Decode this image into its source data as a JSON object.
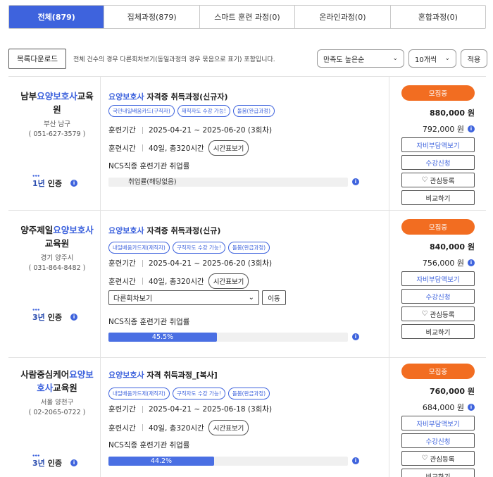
{
  "tabs": [
    {
      "label": "전체(879)",
      "active": true
    },
    {
      "label": "집체과정(879)"
    },
    {
      "label": "스마트 훈련 과정(0)"
    },
    {
      "label": "온라인과정(0)"
    },
    {
      "label": "혼합과정(0)"
    }
  ],
  "toolbar": {
    "download_label": "목록다운로드",
    "notice": "전체 건수의 경우 다른회차보기(동일과정의 경우 묶음으로 표기) 포함입니다.",
    "sort_value": "만족도 높은순",
    "count_value": "10개씩",
    "apply_label": "적용"
  },
  "labels": {
    "period": "훈련기간",
    "hours": "훈련시간",
    "timetable": "시간표보기",
    "ncs": "NCS직종 훈련기관 취업률",
    "cert_suffix": "인증",
    "status": "모집중",
    "self_pay": "자비부담액보기",
    "apply": "수강신청",
    "favorite": "관심등록",
    "compare": "비교하기",
    "session_select": "다른회차보기",
    "move": "이동",
    "won": "원"
  },
  "courses": [
    {
      "inst_pre": "남부",
      "inst_hl": "요양보호사",
      "inst_post": "교육원",
      "region": "부산 남구",
      "phone": "( 051-627-3579 )",
      "cert_years": "1년",
      "title_hl": "요양보호사",
      "title_rest": " 자격증 취득과정(신규자)",
      "badges": [
        "국민내일배움카드(구직자)",
        "재직자도 수강 가능!",
        "돌봄(완급과정)"
      ],
      "period": "2025-04-21 ~ 2025-06-20 (3회차)",
      "hours": "40일, 총320시간",
      "employment": "취업률(해당없음)",
      "employment_pct": 0,
      "price": "880,000 원",
      "sale": "792,000 원"
    },
    {
      "inst_pre": "양주제일",
      "inst_hl": "요양보호사",
      "inst_post": "교육원",
      "region": "경기 양주시",
      "phone": "( 031-864-8482 )",
      "cert_years": "3년",
      "title_hl": "요양보호사",
      "title_rest": " 자격증 취득과정(신규)",
      "badges": [
        "내일배움카드제(재직자)",
        "구직자도 수강 가능!",
        "돌봄(완급과정)"
      ],
      "period": "2025-04-21 ~ 2025-06-20 (3회차)",
      "hours": "40일, 총320시간",
      "employment": "45.5%",
      "employment_pct": 45.5,
      "price": "840,000 원",
      "sale": "756,000 원"
    },
    {
      "inst_pre": "사람중심케어",
      "inst_hl": "요양보호사",
      "inst_post": "교육원",
      "region": "서울 양천구",
      "phone": "( 02-2065-0722 )",
      "cert_years": "3년",
      "title_hl": "요양보호사",
      "title_rest": " 자격 취득과정_[복사]",
      "badges": [
        "내일배움카드제(재직자)",
        "구직자도 수강 가능!",
        "돌봄(완급과정)"
      ],
      "period": "2025-04-21 ~ 2025-06-18 (3회차)",
      "hours": "40일, 총320시간",
      "employment": "44.2%",
      "employment_pct": 44.2,
      "price": "760,000 원",
      "sale": "684,000 원"
    }
  ]
}
